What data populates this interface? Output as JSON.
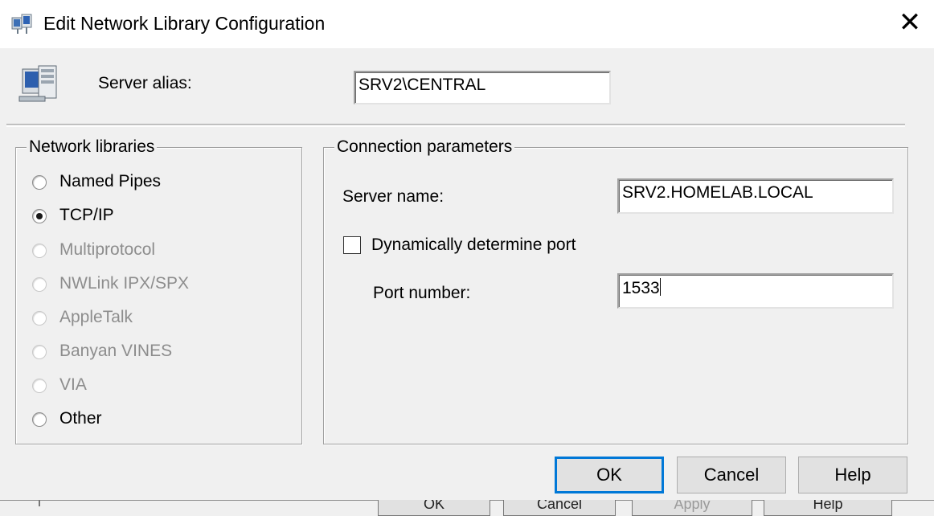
{
  "window": {
    "title": "Edit Network Library Configuration",
    "close_glyph": "✕",
    "icon": "network-config-icon"
  },
  "alias": {
    "icon": "server-computer-icon",
    "label": "Server alias:",
    "value": "SRV2\\CENTRAL"
  },
  "libraries": {
    "legend": "Network libraries",
    "options": [
      {
        "label": "Named Pipes",
        "checked": false,
        "enabled": true
      },
      {
        "label": "TCP/IP",
        "checked": true,
        "enabled": true
      },
      {
        "label": "Multiprotocol",
        "checked": false,
        "enabled": false
      },
      {
        "label": "NWLink IPX/SPX",
        "checked": false,
        "enabled": false
      },
      {
        "label": "AppleTalk",
        "checked": false,
        "enabled": false
      },
      {
        "label": "Banyan VINES",
        "checked": false,
        "enabled": false
      },
      {
        "label": "VIA",
        "checked": false,
        "enabled": false
      },
      {
        "label": "Other",
        "checked": false,
        "enabled": true
      }
    ]
  },
  "connection": {
    "legend": "Connection parameters",
    "server_name_label": "Server name:",
    "server_name_value": "SRV2.HOMELAB.LOCAL",
    "dynamic_port_label": "Dynamically determine port",
    "dynamic_port_checked": false,
    "port_label": "Port number:",
    "port_value": "1533"
  },
  "buttons": {
    "ok": "OK",
    "cancel": "Cancel",
    "help": "Help"
  },
  "background_window": {
    "buttons": [
      "OK",
      "Cancel",
      "Apply",
      "Help"
    ]
  },
  "colors": {
    "dialog_bg": "#f0f0f0",
    "titlebar_bg": "#ffffff",
    "default_button_border": "#0078d7",
    "disabled_text": "#8d8d8d"
  }
}
